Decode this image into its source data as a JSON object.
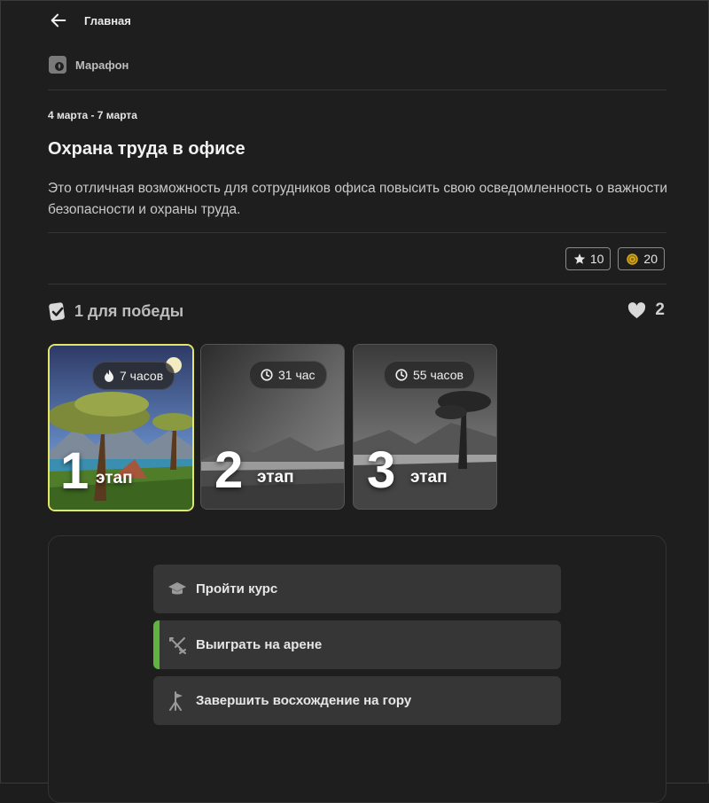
{
  "nav": {
    "back_label": "Главная"
  },
  "category": {
    "label": "Марафон"
  },
  "event": {
    "dates": "4 марта - 7 марта",
    "title": "Охрана труда в офисе",
    "description": "Это отличная возможность для сотрудников офиса повысить свою осведомленность о важности безопасности и охраны труда."
  },
  "badges": {
    "stars": "10",
    "coins": "20"
  },
  "win": {
    "label": "1 для победы"
  },
  "likes": {
    "count": "2"
  },
  "stages": [
    {
      "number": "1",
      "word": "этап",
      "time": "7 часов",
      "time_icon": "flame-icon",
      "status": "active"
    },
    {
      "number": "2",
      "word": "этап",
      "time": "31 час",
      "time_icon": "clock-icon",
      "status": "locked"
    },
    {
      "number": "3",
      "word": "этап",
      "time": "55 часов",
      "time_icon": "clock-icon",
      "status": "locked"
    }
  ],
  "tasks": [
    {
      "label": "Пройти курс",
      "icon": "graduation-cap-icon"
    },
    {
      "label": "Выиграть на арене",
      "icon": "crossed-swords-icon",
      "current": true
    },
    {
      "label": "Завершить восхождение на гору",
      "icon": "climber-flag-icon"
    }
  ],
  "colors": {
    "active_stage_border": "#e4e56b",
    "current_task_accent": "#5fb33e",
    "background": "#1e1e1e"
  }
}
